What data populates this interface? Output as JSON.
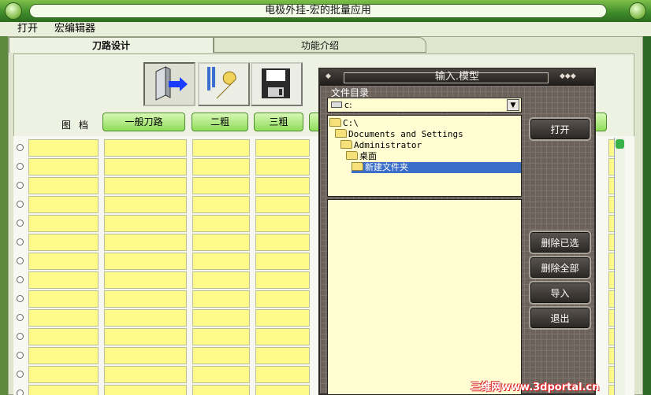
{
  "window": {
    "title": "电极外挂-宏的批量应用"
  },
  "menubar": {
    "items": [
      "打开",
      "宏编辑器"
    ]
  },
  "tabs": [
    {
      "label": "刀路设计",
      "active": true
    },
    {
      "label": "功能介绍",
      "active": false
    }
  ],
  "toolbar": {
    "icons": [
      "import-model-icon",
      "tool-wrench-icon",
      "save-floppy-icon"
    ]
  },
  "category": {
    "label": "图 档",
    "buttons": [
      "一般刀路",
      "二粗",
      "三粗"
    ]
  },
  "grid": {
    "rows": 14
  },
  "dialog": {
    "title": "输入.模型",
    "directory_label": "文件目录",
    "drive_value": "c:",
    "tree": [
      {
        "label": "C:\\",
        "level": 0,
        "selected": false
      },
      {
        "label": "Documents and Settings",
        "level": 1,
        "selected": false
      },
      {
        "label": "Administrator",
        "level": 2,
        "selected": false
      },
      {
        "label": "桌面",
        "level": 3,
        "selected": false
      },
      {
        "label": "新建文件夹",
        "level": 4,
        "selected": true
      }
    ],
    "buttons": {
      "open": "打开",
      "delete_selected": "删除已选",
      "delete_all": "删除全部",
      "import": "导入",
      "exit": "退出"
    }
  },
  "watermark": "三维网www.3dportal.cn",
  "colors": {
    "accent_green": "#8fdc5b",
    "cell_yellow": "#fffb8b",
    "selection": "#3b6ec9"
  }
}
